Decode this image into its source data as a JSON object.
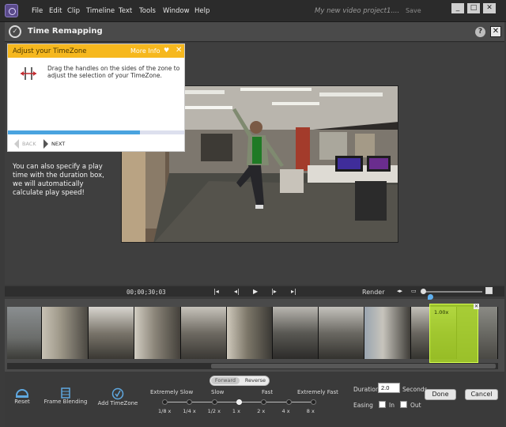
{
  "menubar": {
    "items": [
      "File",
      "Edit",
      "Clip",
      "Timeline",
      "Text",
      "Tools",
      "Window",
      "Help"
    ],
    "project_title": "My new video project1....",
    "save_label": "Save",
    "window_buttons": [
      "_",
      "□",
      "✕"
    ]
  },
  "panel": {
    "title": "Time Remapping",
    "help": "?",
    "close": "✕"
  },
  "tip": {
    "title": "Adjust your TimeZone",
    "more_info": "More Info",
    "body": "Drag the handles on the sides of the zone to adjust the selection of your TimeZone.",
    "back_label": "BACK",
    "next_label": "NEXT",
    "progress": 0.75
  },
  "hint_text": "You can also specify a play time with the duration box, we will automatically calculate play speed!",
  "transport": {
    "timecode": "00;00;30;03",
    "render_label": "Render"
  },
  "timezone": {
    "speed_label": "1.00x"
  },
  "tools": {
    "reset": "Reset",
    "frame_blending": "Frame Blending",
    "add_timezone": "Add TimeZone"
  },
  "direction": {
    "forward": "Forward",
    "reverse": "Reverse"
  },
  "speed": {
    "labels": [
      "Extremely Slow",
      "Slow",
      "Fast",
      "Extremely Fast"
    ],
    "values": [
      "1/8 x",
      "1/4 x",
      "1/2 x",
      "1 x",
      "2 x",
      "4 x",
      "8 x"
    ],
    "selected": "1 x"
  },
  "duration": {
    "label": "Duration",
    "value": "2.0",
    "unit": "Seconds"
  },
  "easing": {
    "label": "Easing",
    "in": "In",
    "out": "Out"
  },
  "buttons": {
    "done": "Done",
    "cancel": "Cancel"
  },
  "colors": {
    "accent_yellow": "#f6b81e",
    "timezone_green": "#addc24",
    "playhead_blue": "#5fb0ef"
  }
}
